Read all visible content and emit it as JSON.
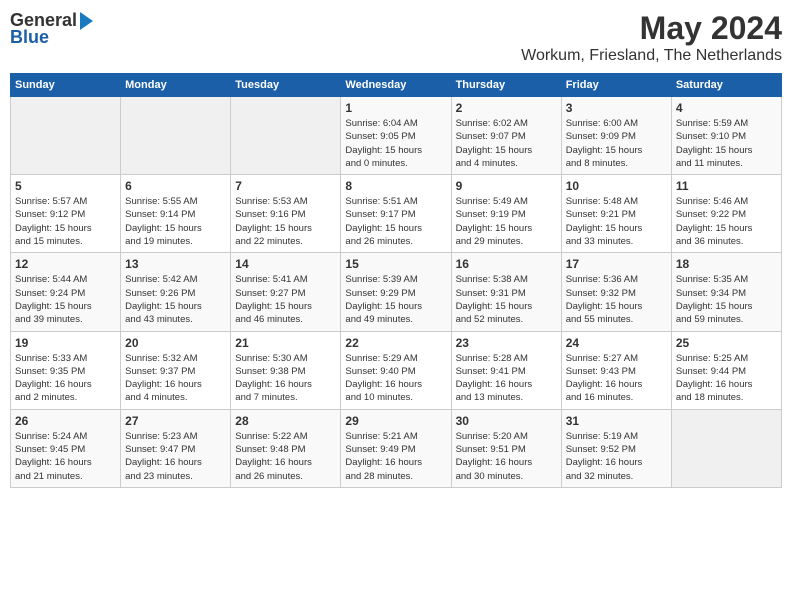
{
  "header": {
    "logo_general": "General",
    "logo_blue": "Blue",
    "title": "May 2024",
    "subtitle": "Workum, Friesland, The Netherlands"
  },
  "days_of_week": [
    "Sunday",
    "Monday",
    "Tuesday",
    "Wednesday",
    "Thursday",
    "Friday",
    "Saturday"
  ],
  "weeks": [
    [
      {
        "day": "",
        "info": ""
      },
      {
        "day": "",
        "info": ""
      },
      {
        "day": "",
        "info": ""
      },
      {
        "day": "1",
        "info": "Sunrise: 6:04 AM\nSunset: 9:05 PM\nDaylight: 15 hours\nand 0 minutes."
      },
      {
        "day": "2",
        "info": "Sunrise: 6:02 AM\nSunset: 9:07 PM\nDaylight: 15 hours\nand 4 minutes."
      },
      {
        "day": "3",
        "info": "Sunrise: 6:00 AM\nSunset: 9:09 PM\nDaylight: 15 hours\nand 8 minutes."
      },
      {
        "day": "4",
        "info": "Sunrise: 5:59 AM\nSunset: 9:10 PM\nDaylight: 15 hours\nand 11 minutes."
      }
    ],
    [
      {
        "day": "5",
        "info": "Sunrise: 5:57 AM\nSunset: 9:12 PM\nDaylight: 15 hours\nand 15 minutes."
      },
      {
        "day": "6",
        "info": "Sunrise: 5:55 AM\nSunset: 9:14 PM\nDaylight: 15 hours\nand 19 minutes."
      },
      {
        "day": "7",
        "info": "Sunrise: 5:53 AM\nSunset: 9:16 PM\nDaylight: 15 hours\nand 22 minutes."
      },
      {
        "day": "8",
        "info": "Sunrise: 5:51 AM\nSunset: 9:17 PM\nDaylight: 15 hours\nand 26 minutes."
      },
      {
        "day": "9",
        "info": "Sunrise: 5:49 AM\nSunset: 9:19 PM\nDaylight: 15 hours\nand 29 minutes."
      },
      {
        "day": "10",
        "info": "Sunrise: 5:48 AM\nSunset: 9:21 PM\nDaylight: 15 hours\nand 33 minutes."
      },
      {
        "day": "11",
        "info": "Sunrise: 5:46 AM\nSunset: 9:22 PM\nDaylight: 15 hours\nand 36 minutes."
      }
    ],
    [
      {
        "day": "12",
        "info": "Sunrise: 5:44 AM\nSunset: 9:24 PM\nDaylight: 15 hours\nand 39 minutes."
      },
      {
        "day": "13",
        "info": "Sunrise: 5:42 AM\nSunset: 9:26 PM\nDaylight: 15 hours\nand 43 minutes."
      },
      {
        "day": "14",
        "info": "Sunrise: 5:41 AM\nSunset: 9:27 PM\nDaylight: 15 hours\nand 46 minutes."
      },
      {
        "day": "15",
        "info": "Sunrise: 5:39 AM\nSunset: 9:29 PM\nDaylight: 15 hours\nand 49 minutes."
      },
      {
        "day": "16",
        "info": "Sunrise: 5:38 AM\nSunset: 9:31 PM\nDaylight: 15 hours\nand 52 minutes."
      },
      {
        "day": "17",
        "info": "Sunrise: 5:36 AM\nSunset: 9:32 PM\nDaylight: 15 hours\nand 55 minutes."
      },
      {
        "day": "18",
        "info": "Sunrise: 5:35 AM\nSunset: 9:34 PM\nDaylight: 15 hours\nand 59 minutes."
      }
    ],
    [
      {
        "day": "19",
        "info": "Sunrise: 5:33 AM\nSunset: 9:35 PM\nDaylight: 16 hours\nand 2 minutes."
      },
      {
        "day": "20",
        "info": "Sunrise: 5:32 AM\nSunset: 9:37 PM\nDaylight: 16 hours\nand 4 minutes."
      },
      {
        "day": "21",
        "info": "Sunrise: 5:30 AM\nSunset: 9:38 PM\nDaylight: 16 hours\nand 7 minutes."
      },
      {
        "day": "22",
        "info": "Sunrise: 5:29 AM\nSunset: 9:40 PM\nDaylight: 16 hours\nand 10 minutes."
      },
      {
        "day": "23",
        "info": "Sunrise: 5:28 AM\nSunset: 9:41 PM\nDaylight: 16 hours\nand 13 minutes."
      },
      {
        "day": "24",
        "info": "Sunrise: 5:27 AM\nSunset: 9:43 PM\nDaylight: 16 hours\nand 16 minutes."
      },
      {
        "day": "25",
        "info": "Sunrise: 5:25 AM\nSunset: 9:44 PM\nDaylight: 16 hours\nand 18 minutes."
      }
    ],
    [
      {
        "day": "26",
        "info": "Sunrise: 5:24 AM\nSunset: 9:45 PM\nDaylight: 16 hours\nand 21 minutes."
      },
      {
        "day": "27",
        "info": "Sunrise: 5:23 AM\nSunset: 9:47 PM\nDaylight: 16 hours\nand 23 minutes."
      },
      {
        "day": "28",
        "info": "Sunrise: 5:22 AM\nSunset: 9:48 PM\nDaylight: 16 hours\nand 26 minutes."
      },
      {
        "day": "29",
        "info": "Sunrise: 5:21 AM\nSunset: 9:49 PM\nDaylight: 16 hours\nand 28 minutes."
      },
      {
        "day": "30",
        "info": "Sunrise: 5:20 AM\nSunset: 9:51 PM\nDaylight: 16 hours\nand 30 minutes."
      },
      {
        "day": "31",
        "info": "Sunrise: 5:19 AM\nSunset: 9:52 PM\nDaylight: 16 hours\nand 32 minutes."
      },
      {
        "day": "",
        "info": ""
      }
    ]
  ]
}
